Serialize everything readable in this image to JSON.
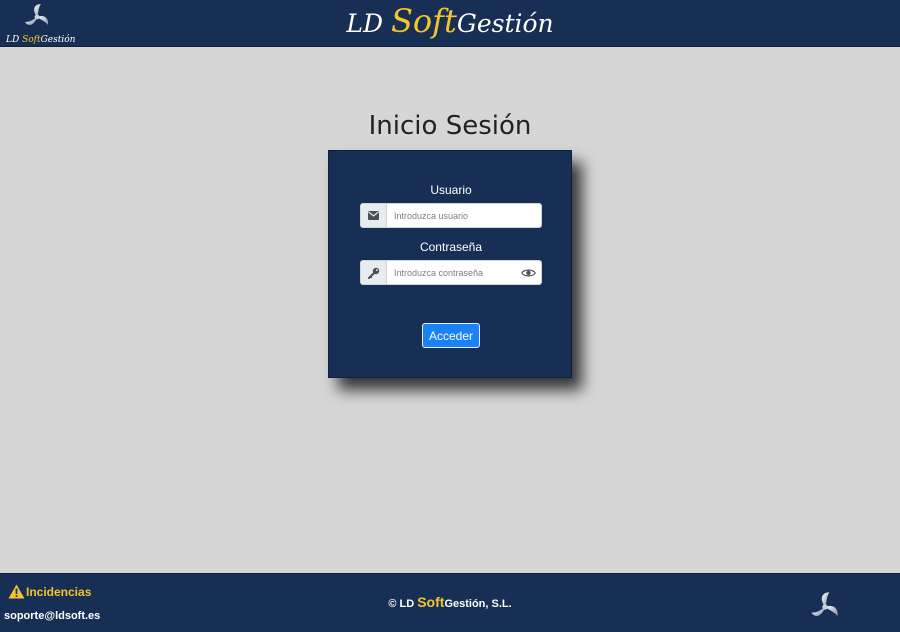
{
  "header": {
    "logo": {
      "text_prefix": "LD ",
      "text_soft": "Soft",
      "text_suffix": "Gestión"
    },
    "brand": {
      "prefix": "LD ",
      "soft": "Soft",
      "suffix": "Gestión"
    }
  },
  "main": {
    "title": "Inicio Sesión",
    "form": {
      "username_label": "Usuario",
      "username_placeholder": "Introduzca usuario",
      "username_value": "",
      "username_icon": "envelope-icon",
      "password_label": "Contraseña",
      "password_placeholder": "Introduzca contraseña",
      "password_value": "",
      "password_icon": "key-icon",
      "toggle_icon": "eye-icon",
      "submit_label": "Acceder"
    }
  },
  "footer": {
    "incidencias_label": "Incidencias",
    "incidencias_icon": "warning-icon",
    "support_email": "soporte@ldsoft.es",
    "copyright": {
      "prefix": "© LD ",
      "soft": "Soft",
      "suffix": "Gestión, S.L."
    }
  },
  "colors": {
    "navy": "#182f55",
    "accent_yellow": "#f2c52a",
    "background": "#d6d6d6",
    "button_blue": "#1a82f7"
  }
}
